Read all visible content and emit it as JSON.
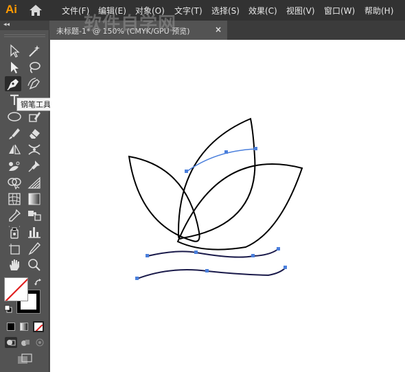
{
  "app": {
    "logo": "Ai",
    "menus": [
      "文件(F)",
      "编辑(E)",
      "对象(O)",
      "文字(T)",
      "选择(S)",
      "效果(C)",
      "视图(V)",
      "窗口(W)",
      "帮助(H)"
    ]
  },
  "toolbar": {
    "collapse_label": "◂◂",
    "tooltip": "钢笔工具 (P)"
  },
  "document": {
    "tab_title": "未标题-1* @ 150% (CMYK/GPU 预览)",
    "close_label": "×"
  },
  "watermark": "软件自学网",
  "colors": {
    "menubar": "#323232",
    "panel": "#535353",
    "accent": "#ff9a00",
    "selection": "#4a7fdc"
  }
}
